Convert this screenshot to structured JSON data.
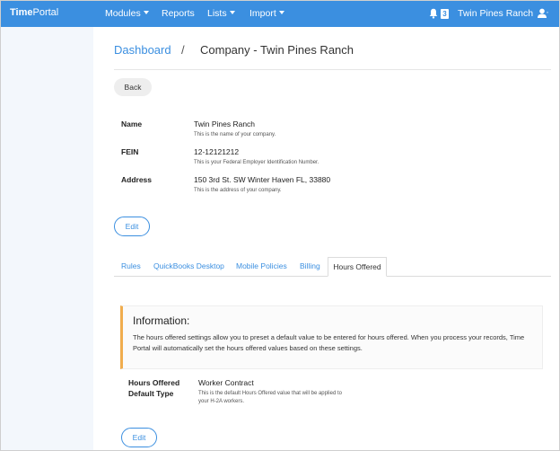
{
  "navbar": {
    "brand_bold": "Time",
    "brand_light": "Portal",
    "menu": [
      {
        "label": "Modules",
        "dropdown": true
      },
      {
        "label": "Reports",
        "dropdown": false
      },
      {
        "label": "Lists",
        "dropdown": true
      },
      {
        "label": "Import",
        "dropdown": true
      }
    ],
    "notification_count": "3",
    "company": "Twin Pines Ranch",
    "user_icon": "user-icon",
    "bell_icon": "bell-icon"
  },
  "breadcrumb": {
    "link": "Dashboard",
    "separator": "/",
    "current": "Company - Twin Pines Ranch"
  },
  "back_label": "Back",
  "company": {
    "fields": [
      {
        "label": "Name",
        "value": "Twin Pines Ranch",
        "hint": "This is the name of your company."
      },
      {
        "label": "FEIN",
        "value": "12-12121212",
        "hint": "This is your Federal Employer Identification Number."
      },
      {
        "label": "Address",
        "value": "150 3rd St. SW Winter Haven FL, 33880",
        "hint": "This is the address of your company."
      }
    ],
    "edit_label": "Edit"
  },
  "tabs": [
    {
      "label": "Rules",
      "active": false
    },
    {
      "label": "QuickBooks Desktop",
      "active": false
    },
    {
      "label": "Mobile Policies",
      "active": false
    },
    {
      "label": "Billing",
      "active": false
    },
    {
      "label": "Hours Offered",
      "active": true
    }
  ],
  "info": {
    "title": "Information:",
    "body": "The hours offered settings allow you to preset a default value to be entered for hours offered. When you process your records, Time Portal will automatically set the hours offered values based on these settings."
  },
  "hours_offered": {
    "label_line1": "Hours Offered",
    "label_line2": "Default Type",
    "value": "Worker Contract",
    "hint_line1": "This is the default Hours Offered value that will be applied to",
    "hint_line2": "your H-2A workers.",
    "edit_label": "Edit"
  },
  "colors": {
    "primary": "#3b8fe0",
    "warning_border": "#f0ad4e"
  }
}
